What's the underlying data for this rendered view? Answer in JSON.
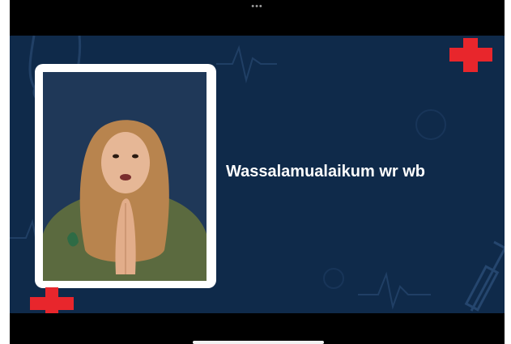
{
  "slide": {
    "greeting": "Wassalamualaikum wr wb",
    "background_color": "#0f2a4a",
    "accent_color": "#e8262c"
  },
  "icons": {
    "top_menu": "more-horizontal-icon",
    "crosses": "medical-cross-icon",
    "decor": [
      "stethoscope-icon",
      "heartbeat-line-icon",
      "syringe-icon"
    ]
  },
  "participant_video": {
    "description_icon": "person-video-feed"
  }
}
